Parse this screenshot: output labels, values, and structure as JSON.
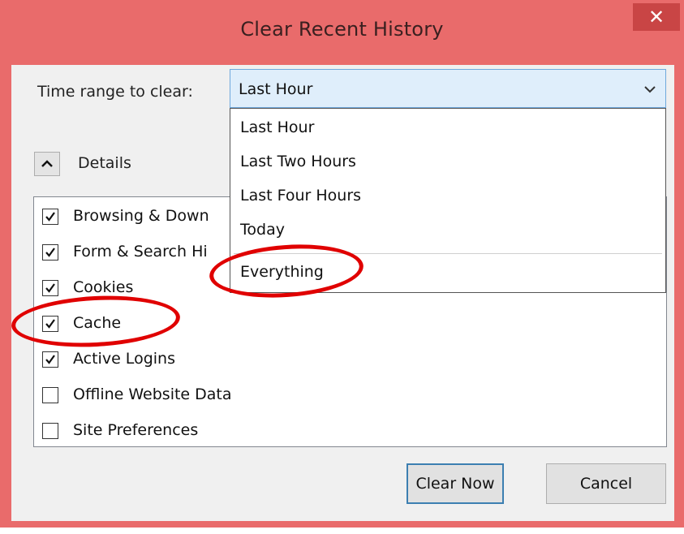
{
  "window": {
    "title": "Clear Recent History",
    "close_icon": "close-icon",
    "accent_color": "#e96b6b"
  },
  "time_range": {
    "label": "Time range to clear:",
    "selected": "Last Hour",
    "options": [
      "Last Hour",
      "Last Two Hours",
      "Last Four Hours",
      "Today",
      "Everything"
    ]
  },
  "details": {
    "label": "Details",
    "icon": "chevron-up-icon"
  },
  "items": [
    {
      "label": "Browsing & Down",
      "checked": true
    },
    {
      "label": "Form & Search Hi",
      "checked": true
    },
    {
      "label": "Cookies",
      "checked": true
    },
    {
      "label": "Cache",
      "checked": true
    },
    {
      "label": "Active Logins",
      "checked": true
    },
    {
      "label": "Offline Website Data",
      "checked": false
    },
    {
      "label": "Site Preferences",
      "checked": false
    }
  ],
  "buttons": {
    "clear_now": "Clear Now",
    "cancel": "Cancel"
  },
  "annotations": {
    "color": "#e00000",
    "highlighted": [
      "Everything",
      "Cache"
    ]
  }
}
